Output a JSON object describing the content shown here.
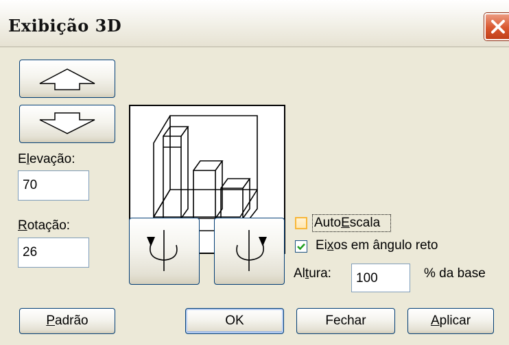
{
  "window": {
    "title": "Exibição 3D"
  },
  "elevation": {
    "label_prefix": "E",
    "label_accel": "l",
    "label_suffix": "evação:",
    "value": "70"
  },
  "rotation": {
    "label_prefix": "",
    "label_accel": "R",
    "label_suffix": "otação:",
    "value": "26"
  },
  "options": {
    "autoscale_prefix": "Auto",
    "autoscale_accel": "E",
    "autoscale_suffix": "scala",
    "autoscale_checked": false,
    "right_angle_prefix": "Ei",
    "right_angle_accel": "x",
    "right_angle_suffix": "os em ângulo reto",
    "right_angle_checked": true,
    "height_prefix": "Al",
    "height_accel": "t",
    "height_suffix": "ura:",
    "height_value": "100",
    "height_unit": "% da base"
  },
  "buttons": {
    "default_prefix": "",
    "default_accel": "P",
    "default_suffix": "adrão",
    "ok": "OK",
    "close": "Fechar",
    "apply_prefix": "",
    "apply_accel": "A",
    "apply_suffix": "plicar"
  },
  "icons": {
    "close": "close-icon",
    "elevate_up": "arrow-up-icon",
    "elevate_down": "arrow-down-icon",
    "rotate_left": "rotate-left-icon",
    "rotate_right": "rotate-right-icon"
  }
}
